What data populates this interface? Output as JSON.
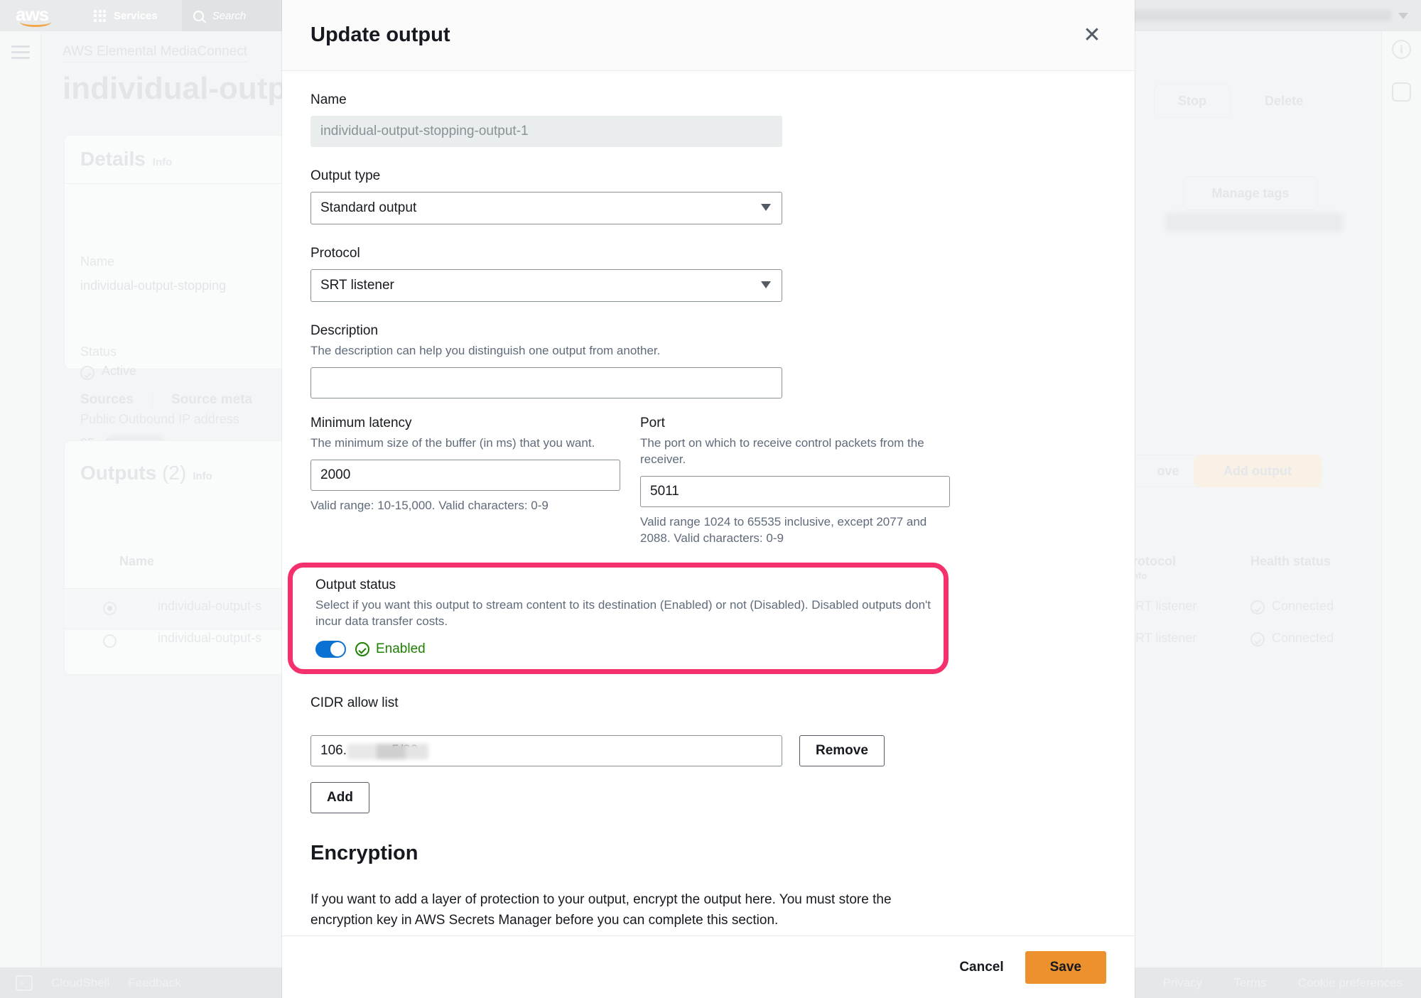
{
  "console": {
    "logo_text": "aws",
    "services_label": "Services",
    "search_placeholder": "Search",
    "region_label": "kyo",
    "breadcrumb": "AWS Elemental MediaConnect",
    "page_title": "individual-outp",
    "details_card": {
      "heading": "Details",
      "info_link": "Info",
      "name_label": "Name",
      "name_value": "individual-output-stopping",
      "status_label": "Status",
      "status_value": "Active",
      "ip_label": "Public Outbound IP address",
      "ip_value": "35.     .90"
    },
    "actions": {
      "stop": "Stop",
      "delete": "Delete",
      "manage_tags": "Manage tags"
    },
    "tabs": [
      "Sources",
      "Source meta"
    ],
    "outputs_card": {
      "heading": "Outputs",
      "count": "(2)",
      "info_link": "Info",
      "remove_button": "ove",
      "add_output_button": "Add output",
      "columns": [
        "Name",
        "rotocol",
        "Health status"
      ],
      "column_sub": "nfo",
      "rows": [
        {
          "name": "individual-output-s",
          "protocol": "RT listener",
          "health": "Connected",
          "selected": true
        },
        {
          "name": "individual-output-s",
          "protocol": "RT listener",
          "health": "Connected",
          "selected": false
        }
      ]
    },
    "bottom_bar": {
      "cloudshell": "CloudShell",
      "feedback": "Feedback",
      "privacy": "Privacy",
      "terms": "Terms",
      "cookie_preferences": "Cookie preferences"
    }
  },
  "modal": {
    "title": "Update output",
    "close_icon": "close-icon",
    "name": {
      "label": "Name",
      "value": "individual-output-stopping-output-1"
    },
    "output_type": {
      "label": "Output type",
      "value": "Standard output"
    },
    "protocol": {
      "label": "Protocol",
      "value": "SRT listener"
    },
    "description": {
      "label": "Description",
      "desc": "The description can help you distinguish one output from another.",
      "value": ""
    },
    "minimum_latency": {
      "label": "Minimum latency",
      "desc": "The minimum size of the buffer (in ms) that you want.",
      "value": "2000",
      "hint": "Valid range: 10-15,000. Valid characters: 0-9"
    },
    "port": {
      "label": "Port",
      "desc": "The port on which to receive control packets from the receiver.",
      "value": "5011",
      "hint": "Valid range 1024 to 65535 inclusive, except 2077 and 2088. Valid characters: 0-9"
    },
    "output_status": {
      "label": "Output status",
      "desc": "Select if you want this output to stream content to its destination (Enabled) or not (Disabled). Disabled outputs don't incur data transfer costs.",
      "toggle_on": true,
      "status_text": "Enabled",
      "highlight_color": "#f4316d"
    },
    "cidr_allow_list": {
      "label": "CIDR allow list",
      "value": "106.            5/32",
      "remove_button": "Remove",
      "add_button": "Add"
    },
    "encryption": {
      "title": "Encryption",
      "paragraph": "If you want to add a layer of protection to your output, encrypt the output here. You must store the encryption key in AWS Secrets Manager before you can complete this section."
    },
    "footer": {
      "cancel": "Cancel",
      "save": "Save"
    }
  }
}
